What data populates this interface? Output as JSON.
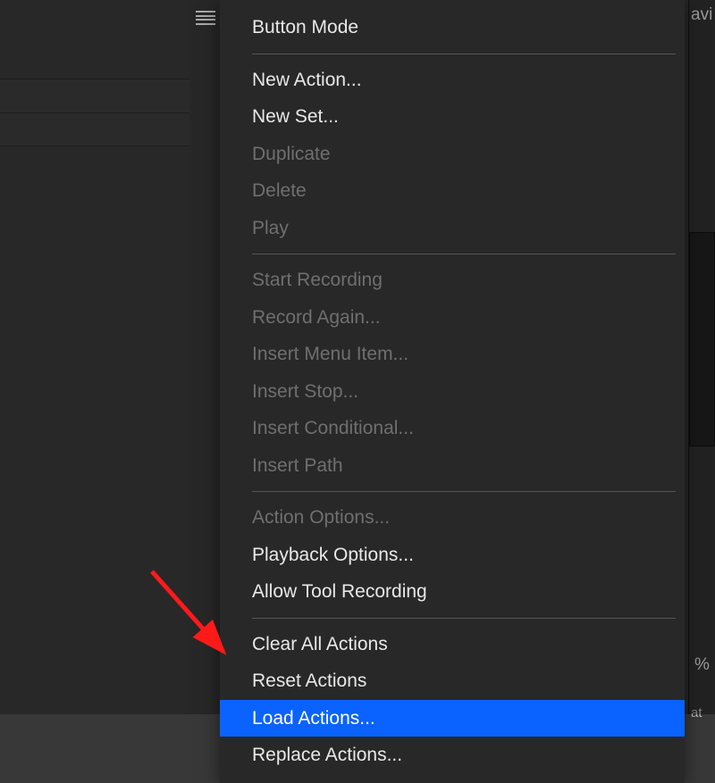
{
  "right_fragments": {
    "top": "avi",
    "percent": "%",
    "bottom": "at"
  },
  "menu": {
    "groups": [
      {
        "items": [
          {
            "id": "button-mode",
            "label": "Button Mode",
            "enabled": true
          }
        ]
      },
      {
        "items": [
          {
            "id": "new-action",
            "label": "New Action...",
            "enabled": true
          },
          {
            "id": "new-set",
            "label": "New Set...",
            "enabled": true
          },
          {
            "id": "duplicate",
            "label": "Duplicate",
            "enabled": false
          },
          {
            "id": "delete",
            "label": "Delete",
            "enabled": false
          },
          {
            "id": "play",
            "label": "Play",
            "enabled": false
          }
        ]
      },
      {
        "items": [
          {
            "id": "start-recording",
            "label": "Start Recording",
            "enabled": false
          },
          {
            "id": "record-again",
            "label": "Record Again...",
            "enabled": false
          },
          {
            "id": "insert-menu-item",
            "label": "Insert Menu Item...",
            "enabled": false
          },
          {
            "id": "insert-stop",
            "label": "Insert Stop...",
            "enabled": false
          },
          {
            "id": "insert-conditional",
            "label": "Insert Conditional...",
            "enabled": false
          },
          {
            "id": "insert-path",
            "label": "Insert Path",
            "enabled": false
          }
        ]
      },
      {
        "items": [
          {
            "id": "action-options",
            "label": "Action Options...",
            "enabled": false
          },
          {
            "id": "playback-options",
            "label": "Playback Options...",
            "enabled": true
          },
          {
            "id": "allow-tool-recording",
            "label": "Allow Tool Recording",
            "enabled": true
          }
        ]
      },
      {
        "items": [
          {
            "id": "clear-all-actions",
            "label": "Clear All Actions",
            "enabled": true
          },
          {
            "id": "reset-actions",
            "label": "Reset Actions",
            "enabled": true
          },
          {
            "id": "load-actions",
            "label": "Load Actions...",
            "enabled": true,
            "highlight": true
          },
          {
            "id": "replace-actions",
            "label": "Replace Actions...",
            "enabled": true
          }
        ]
      }
    ]
  }
}
